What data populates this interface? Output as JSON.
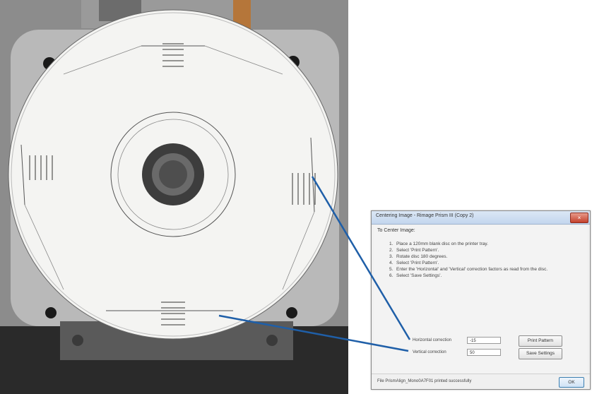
{
  "dialog": {
    "title": "Centering Image - Rimage Prism III (Copy 2)",
    "close_label": "×",
    "heading": "To Center Image:",
    "steps": [
      {
        "num": "1.",
        "text": "Place a 120mm blank disc on the printer tray."
      },
      {
        "num": "2.",
        "text": "Select 'Print Pattern'."
      },
      {
        "num": "3.",
        "text": "Rotate disc 180 degrees."
      },
      {
        "num": "4.",
        "text": "Select 'Print Pattern'."
      },
      {
        "num": "5.",
        "text": "Enter the 'Horizontal' and 'Vertical' correction factors as read from the disc."
      },
      {
        "num": "6.",
        "text": "Select 'Save Settings'."
      }
    ],
    "horizontal_label": "Horizontal correction",
    "horizontal_value": "-15",
    "vertical_label": "Vertical correction",
    "vertical_value": "50",
    "print_pattern_label": "Print Pattern",
    "save_settings_label": "Save Settings",
    "status_text": "File PrismAlign_Mono0A7F01 printed successfully",
    "ok_label": "OK"
  },
  "colors": {
    "callout_line": "#1f5fa8",
    "titlebar": "#c3d6ee",
    "close_button": "#c4412c"
  }
}
